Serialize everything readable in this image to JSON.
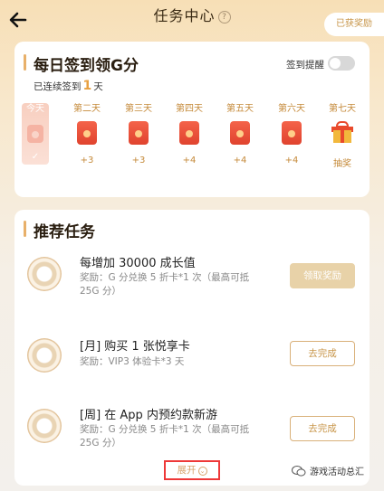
{
  "header": {
    "title": "任务中心",
    "help": "?",
    "earned_button": "已获奖励"
  },
  "signin": {
    "title": "每日签到领G分",
    "streak_prefix": "已连续签到",
    "streak_days": "1",
    "streak_suffix": "天",
    "reminder_label": "签到提醒",
    "reminder_on": false,
    "days": [
      {
        "label": "今天",
        "reward": "✓",
        "state": "done"
      },
      {
        "label": "第二天",
        "reward": "+3"
      },
      {
        "label": "第三天",
        "reward": "+3"
      },
      {
        "label": "第四天",
        "reward": "+4"
      },
      {
        "label": "第五天",
        "reward": "+4"
      },
      {
        "label": "第六天",
        "reward": "+4"
      },
      {
        "label": "第七天",
        "reward": "抽奖",
        "icon": "gift-icon"
      }
    ]
  },
  "recommend": {
    "title": "推荐任务",
    "tasks": [
      {
        "title": "每增加 30000 成长值",
        "desc": "奖励：G 分兑换 5 折卡*1 次（最高可抵 25G 分）",
        "button": "领取奖励"
      },
      {
        "title": "[月] 购买 1 张悦享卡",
        "desc": "奖励：VIP3 体验卡*3 天",
        "button": "去完成"
      },
      {
        "title": "[周] 在 App 内预约款新游",
        "desc": "奖励：G 分兑换 5 折卡*1 次（最高可抵 25G 分）",
        "button": "去完成"
      }
    ],
    "expand": "展开"
  },
  "watermark": "游戏活动总汇",
  "colors": {
    "accent": "#e8b06a",
    "red_envelope": "#e0432e",
    "highlight_box": "#ee3838"
  }
}
